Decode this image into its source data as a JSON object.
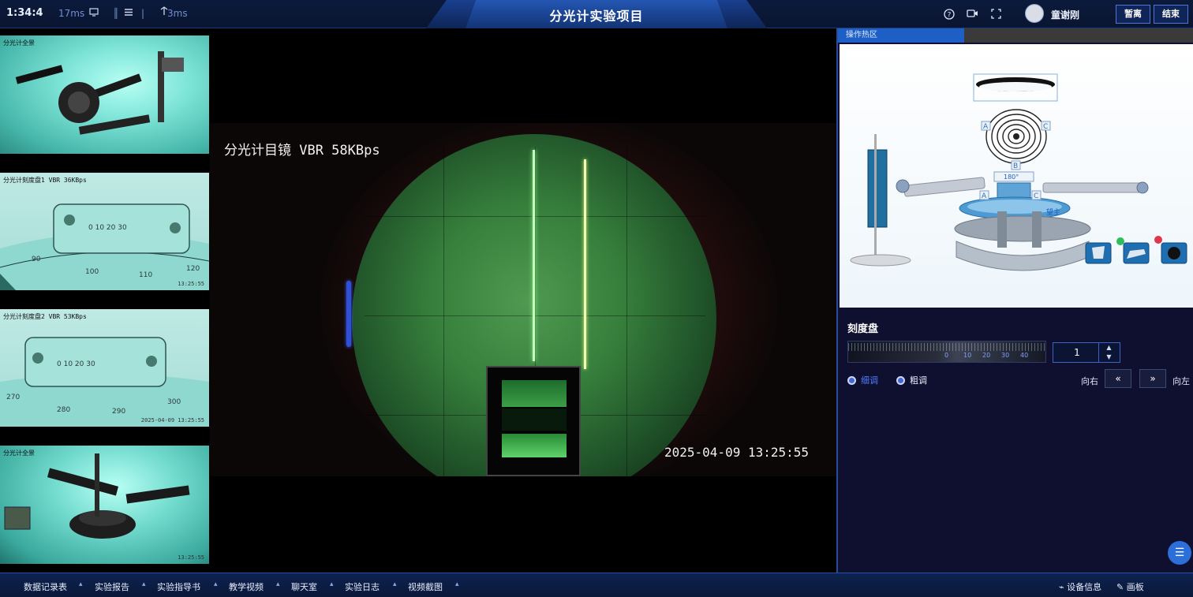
{
  "topbar": {
    "clock": "1:34:4",
    "latency": "17ms",
    "ping": "3ms",
    "title": "分光计实验项目",
    "user_name": "童谢刚",
    "btn_leave": "暂离",
    "btn_end": "结束",
    "icons": [
      "monitor-icon",
      "list-icon",
      "signal-icon",
      "help-icon",
      "camera-icon",
      "fullscreen-icon"
    ]
  },
  "thumbs": [
    {
      "label": "分光计全景",
      "time": ""
    },
    {
      "label": "分光计刻度盘1 VBR 36KBps",
      "time": "13:25:55"
    },
    {
      "label": "分光计刻度盘2 VBR 53KBps",
      "time": "2025-04-09  13:25:55"
    },
    {
      "label": "分光计全景",
      "time": "13:25:55"
    }
  ],
  "main_view": {
    "osd_title": "分光计目镜 VBR 58KBps",
    "osd_time": "2025-04-09  13:25:55"
  },
  "right_panel": {
    "tab_label": "操作热区",
    "diagram_labels": [
      "A",
      "C",
      "B",
      "A",
      "C",
      "180°",
      "望主"
    ],
    "dial_title": "刻度盘",
    "dial_numbers": [
      "0",
      "10",
      "20",
      "30",
      "40"
    ],
    "value": "1",
    "radio_fine": "细调",
    "radio_coarse": "粗调",
    "dir_right": "向右",
    "dir_left": "向左",
    "btn_prev": "«",
    "btn_next": "»",
    "fab_icon": "☰"
  },
  "bottombar": {
    "items": [
      "数据记录表",
      "实验报告",
      "实验指导书",
      "教学视频",
      "聊天室",
      "实验日志",
      "视频截图"
    ],
    "device_info": "设备信息",
    "drawboard": "画板"
  },
  "colors": {
    "accent": "#1d5fc4",
    "panel_bg": "#0f1030",
    "top_bg": "#0b1a3c"
  }
}
